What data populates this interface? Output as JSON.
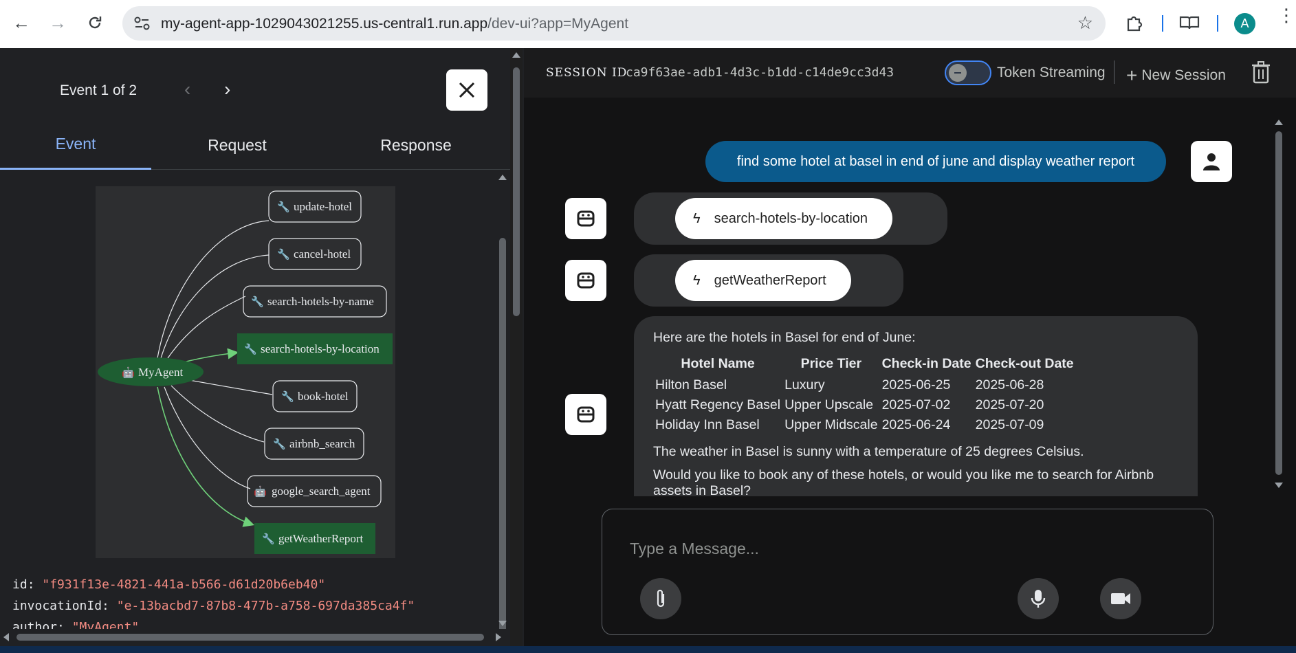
{
  "browser": {
    "url_host": "my-agent-app-1029043021255.us-central1.run.app",
    "url_path": "/dev-ui?app=MyAgent",
    "profile_initial": "A"
  },
  "event_panel": {
    "counter": "Event 1 of 2",
    "tabs": [
      "Event",
      "Request",
      "Response"
    ],
    "graph": {
      "root": "MyAgent",
      "nodes": [
        "update-hotel",
        "cancel-hotel",
        "search-hotels-by-name",
        "search-hotels-by-location",
        "book-hotel",
        "airbnb_search",
        "google_search_agent",
        "getWeatherReport"
      ]
    },
    "json": [
      {
        "key": "id",
        "value": "\"f931f13e-4821-441a-b566-d61d20b6eb40\""
      },
      {
        "key": "invocationId",
        "value": "\"e-13bacbd7-87b8-477b-a758-697da385ca4f\""
      },
      {
        "key": "author",
        "value": "\"MyAgent\""
      }
    ]
  },
  "session": {
    "label": "SESSION ID",
    "id": "ca9f63ae-adb1-4d3c-b1dd-c14de9cc3d43",
    "token_streaming_label": "Token Streaming",
    "new_session_label": "New Session"
  },
  "chat": {
    "user_message": "find some hotel at basel in end of june and display weather report",
    "tool_calls": [
      "search-hotels-by-location",
      "getWeatherReport"
    ],
    "response": {
      "intro": "Here are the hotels in Basel for end of June:",
      "table_headers": [
        "Hotel Name",
        "Price Tier",
        "Check-in Date",
        "Check-out Date"
      ],
      "table_rows": [
        [
          "Hilton Basel",
          "Luxury",
          "2025-06-25",
          "2025-06-28"
        ],
        [
          "Hyatt Regency Basel",
          "Upper Upscale",
          "2025-07-02",
          "2025-07-20"
        ],
        [
          "Holiday Inn Basel",
          "Upper Midscale",
          "2025-06-24",
          "2025-07-09"
        ]
      ],
      "weather": "The weather in Basel is sunny with a temperature of 25 degrees Celsius.",
      "question": "Would you like to book any of these hotels, or would you like me to search for Airbnb assets in Basel?"
    },
    "input_placeholder": "Type a Message..."
  }
}
